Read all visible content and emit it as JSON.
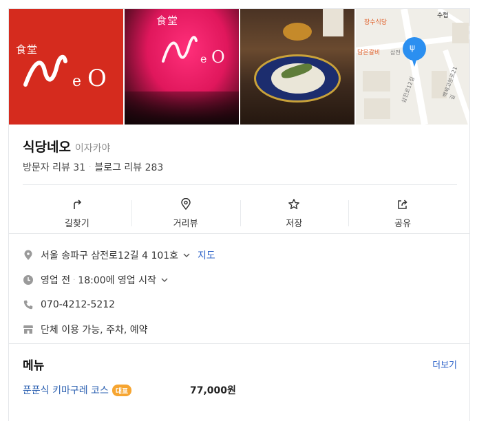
{
  "photos": {
    "logo_small": "食堂",
    "logo_text": "NeO",
    "map": {
      "poi_top": "장수식당",
      "poi_right": "수협",
      "poi_left": "담은갈비",
      "road_1": "삼전로12길",
      "road_2": "백제고분로21길",
      "road_3": "삼전"
    }
  },
  "place": {
    "name": "식당네오",
    "category": "이자카야",
    "visitor_reviews": "방문자 리뷰 31",
    "blog_reviews": "블로그 리뷰 283"
  },
  "actions": [
    {
      "label": "길찾기",
      "icon": "directions-icon"
    },
    {
      "label": "거리뷰",
      "icon": "street-view-icon"
    },
    {
      "label": "저장",
      "icon": "star-icon"
    },
    {
      "label": "공유",
      "icon": "share-icon"
    }
  ],
  "info": {
    "address": "서울 송파구 삼전로12길 4 101호",
    "map_link": "지도",
    "status": "영업 전",
    "hours": "18:00에 영업 시작",
    "phone": "070-4212-5212",
    "amenities": "단체 이용 가능, 주차, 예약"
  },
  "menu": {
    "title": "메뉴",
    "more": "더보기",
    "items": [
      {
        "name": "푼푼식 키마구레 코스",
        "badge": "대표",
        "price": "77,000원"
      }
    ]
  },
  "colors": {
    "brand_red": "#d52b1e",
    "link_blue": "#2e63c9",
    "badge_orange": "#f6a531",
    "map_pin": "#2b8ff0"
  }
}
